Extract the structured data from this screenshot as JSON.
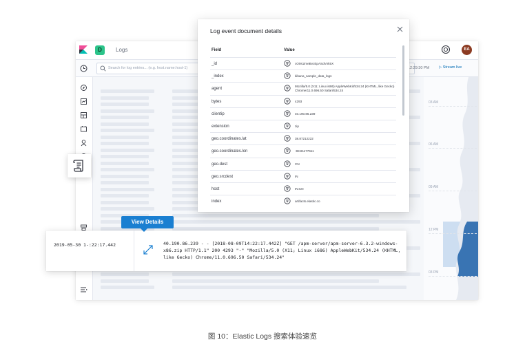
{
  "header": {
    "space_initial": "D",
    "app_title": "Logs",
    "user_initials": "EA"
  },
  "search": {
    "placeholder": "Search for log entries... (e.g. host.name:host-1)",
    "time_text": "12:29:30 PM",
    "stream_live_label": "▷ Stream live"
  },
  "timeline": {
    "labels": [
      "03 AM",
      "06 AM",
      "09 AM",
      "12 PM",
      "03 PM"
    ]
  },
  "flyout": {
    "title": "Log event document details",
    "field_header": "Field",
    "value_header": "Value",
    "rows": [
      {
        "field": "_id",
        "value": "cO0s1imeBvcEpASdVnk5X"
      },
      {
        "field": "_index",
        "value": "kibana_sample_data_logs"
      },
      {
        "field": "agent",
        "value": "Mozilla/5.0 (X11; Linux i686) AppleWebKit/534.24 (KHTML, like Gecko) Chrome/11.0.696.50 Safari/534.24"
      },
      {
        "field": "bytes",
        "value": "4293"
      },
      {
        "field": "clientip",
        "value": "40.190.86.239"
      },
      {
        "field": "extension",
        "value": "zip"
      },
      {
        "field": "geo.coordinates.lat",
        "value": "38.87212222"
      },
      {
        "field": "geo.coordinates.lon",
        "value": "-98.81177611"
      },
      {
        "field": "geo.dest",
        "value": "CN"
      },
      {
        "field": "geo.srcdest",
        "value": "IN"
      },
      {
        "field": "host",
        "value": "IN:CN"
      },
      {
        "field": "index",
        "value": "artifacts.elastic.co"
      }
    ]
  },
  "log_entry": {
    "timestamp": "2019-05-30   1-:22:17.442",
    "message": "40.190.86.239 - - [2018-08-09T14:22:17.442Z]  \"GET  /apm-server/apm-server-6.3.2-windows-x86.zip HTTP/1.1\"  200 4293  \"-\" \"Mozilla/5.0  (X11;  Linux  i686) AppleWebKit/534.24  (KHTML,  like Gecko)  Chrome/11.0.696.50 Safari/534.24\"",
    "view_details_label": "View Details"
  },
  "caption": "图 10：Elastic Logs 搜索体验速览",
  "colors": {
    "accent": "#1a7fd1",
    "space_badge": "#2bc48a",
    "avatar": "#8c3b22",
    "timeline_highlight": "#79aad9"
  },
  "icons": [
    "elastic-logo-icon",
    "help-icon",
    "clock-icon",
    "search-icon",
    "close-icon",
    "filter-icon",
    "expand-icon",
    "logs-app-icon",
    "nav-collapse-icon"
  ]
}
